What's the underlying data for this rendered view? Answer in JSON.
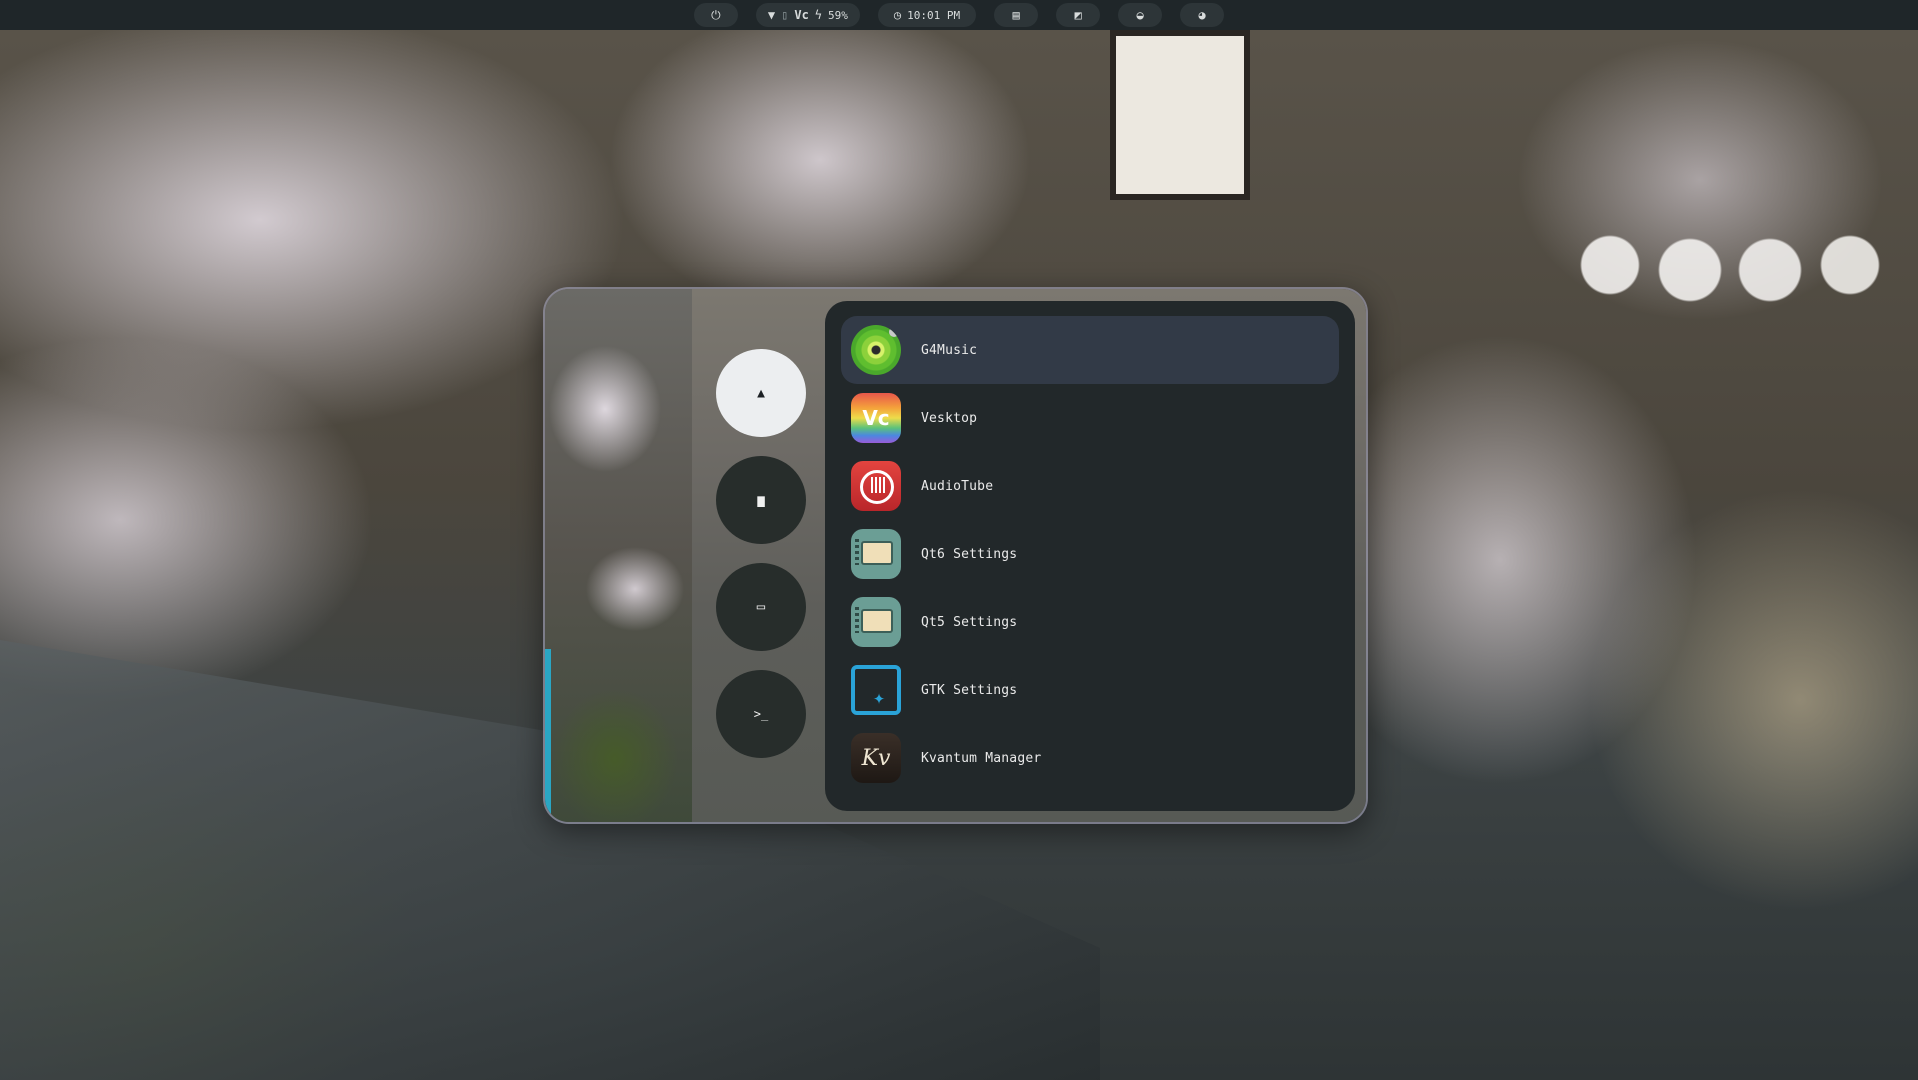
{
  "topbar": {
    "power_icon": "power-icon",
    "status": {
      "wifi_icon": "wifi-icon",
      "bluetooth_icon": "bluetooth-icon",
      "vesktop_icon": "vesktop-tray-icon",
      "battery_percent": "59%"
    },
    "clock": "10:01 PM",
    "buttons": [
      "clipboard-icon",
      "screenshot-icon",
      "ghost-icon",
      "palette-icon"
    ]
  },
  "launcher": {
    "sidebar": [
      {
        "icon": "arch-logo-icon",
        "glyph": "▲",
        "active": true
      },
      {
        "icon": "folder-icon",
        "glyph": "▆",
        "active": false
      },
      {
        "icon": "window-icon",
        "glyph": "▭",
        "active": false
      },
      {
        "icon": "terminal-icon",
        "glyph": ">_",
        "active": false
      }
    ],
    "apps": [
      {
        "name": "G4Music",
        "icon": "g4music-icon",
        "selected": true
      },
      {
        "name": "Vesktop",
        "icon": "vesktop-icon",
        "selected": false
      },
      {
        "name": "AudioTube",
        "icon": "audiotube-icon",
        "selected": false
      },
      {
        "name": "Qt6 Settings",
        "icon": "qt6-settings-icon",
        "selected": false
      },
      {
        "name": "Qt5 Settings",
        "icon": "qt5-settings-icon",
        "selected": false
      },
      {
        "name": "GTK Settings",
        "icon": "gtk-settings-icon",
        "selected": false
      },
      {
        "name": "Kvantum Manager",
        "icon": "kvantum-icon",
        "selected": false
      }
    ],
    "colors": {
      "panel": "#22282a",
      "selected_row": "#323a47",
      "sidebar_button": "#272d2b",
      "sidebar_active": "#eceef0",
      "topbar": "#1f2629"
    }
  }
}
